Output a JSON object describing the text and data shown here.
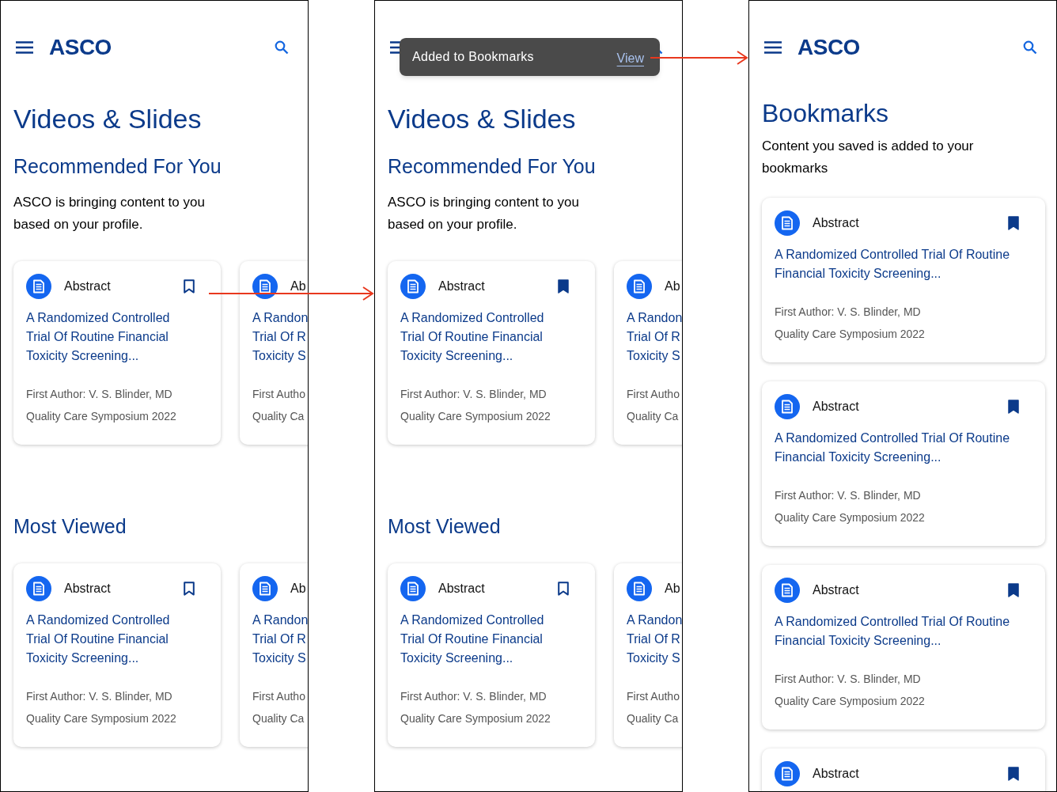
{
  "screens": [
    {
      "header": {
        "logo": "ASCO"
      },
      "title": "Videos & Slides",
      "sections": [
        {
          "heading": "Recommended For You",
          "description": "ASCO is bringing content to you based on your profile.",
          "cards": [
            {
              "type_label": "Abstract",
              "bookmarked": false,
              "title": "A Randomized Controlled Trial Of Routine Financial Toxicity Screening...",
              "author": "First Author: V. S. Blinder, MD",
              "event": "Quality Care Symposium 2022"
            },
            {
              "type_label": "Ab",
              "title_lines": [
                "A Randon",
                "Trial Of R",
                "Toxicity S"
              ],
              "author": "First Autho",
              "event": "Quality Ca"
            }
          ]
        },
        {
          "heading": "Most Viewed",
          "cards": [
            {
              "type_label": "Abstract",
              "bookmarked": false,
              "title": "A Randomized Controlled Trial Of Routine Financial Toxicity Screening...",
              "author": "First Author: V. S. Blinder, MD",
              "event": "Quality Care Symposium 2022"
            },
            {
              "type_label": "Ab",
              "title_lines": [
                "A Randon",
                "Trial Of R",
                "Toxicity S"
              ],
              "author": "First Autho",
              "event": "Quality Ca"
            }
          ]
        }
      ]
    },
    {
      "toast": {
        "message": "Added to Bookmarks",
        "action": "View"
      },
      "title": "Videos & Slides",
      "sections": [
        {
          "heading": "Recommended For You",
          "description": "ASCO is bringing content to you based on your profile.",
          "cards": [
            {
              "type_label": "Abstract",
              "bookmarked": true,
              "title": "A Randomized Controlled Trial Of Routine Financial Toxicity Screening...",
              "author": "First Author: V. S. Blinder, MD",
              "event": "Quality Care Symposium 2022"
            },
            {
              "type_label": "Ab",
              "title_lines": [
                "A Randon",
                "Trial Of R",
                "Toxicity S"
              ],
              "author": "First Autho",
              "event": "Quality Ca"
            }
          ]
        },
        {
          "heading": "Most Viewed",
          "cards": [
            {
              "type_label": "Abstract",
              "bookmarked": false,
              "title": "A Randomized Controlled Trial Of Routine Financial Toxicity Screening...",
              "author": "First Author: V. S. Blinder, MD",
              "event": "Quality Care Symposium 2022"
            },
            {
              "type_label": "Ab",
              "title_lines": [
                "A Randon",
                "Trial Of R",
                "Toxicity S"
              ],
              "author": "First Autho",
              "event": "Quality Ca"
            }
          ]
        }
      ]
    },
    {
      "header": {
        "logo": "ASCO"
      },
      "title": "Bookmarks",
      "description": "Content you saved is added to your bookmarks",
      "list": [
        {
          "type_label": "Abstract",
          "bookmarked": true,
          "title": "A Randomized Controlled Trial Of Routine Financial Toxicity Screening...",
          "author": "First Author: V. S. Blinder, MD",
          "event": "Quality Care Symposium 2022"
        },
        {
          "type_label": "Abstract",
          "bookmarked": true,
          "title": "A Randomized Controlled Trial Of Routine Financial Toxicity Screening...",
          "author": "First Author: V. S. Blinder, MD",
          "event": "Quality Care Symposium 2022"
        },
        {
          "type_label": "Abstract",
          "bookmarked": true,
          "title": "A Randomized Controlled Trial Of Routine Financial Toxicity Screening...",
          "author": "First Author: V. S. Blinder, MD",
          "event": "Quality Care Symposium 2022"
        },
        {
          "type_label": "Abstract",
          "bookmarked": true
        }
      ]
    }
  ]
}
